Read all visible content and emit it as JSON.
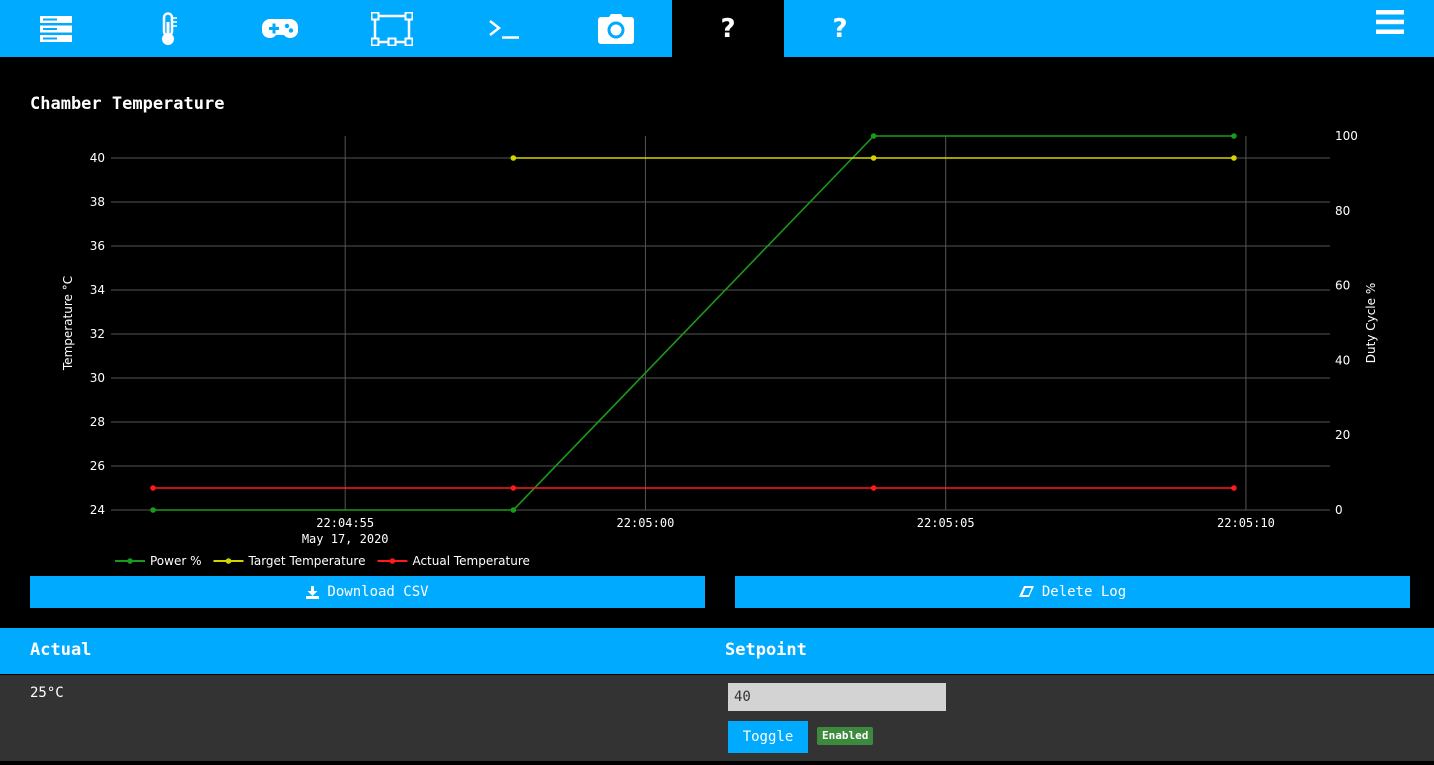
{
  "nav": {
    "tabs": [
      {
        "icon": "server-icon"
      },
      {
        "icon": "thermometer-icon"
      },
      {
        "icon": "gamepad-icon"
      },
      {
        "icon": "bounding-box-icon"
      },
      {
        "icon": "terminal-icon"
      },
      {
        "icon": "camera-icon"
      },
      {
        "icon": "question-icon",
        "label": "?",
        "active": true
      },
      {
        "icon": "question-icon",
        "label": "?"
      }
    ],
    "menu_icon": "hamburger-menu-icon"
  },
  "chart_title": "Chamber Temperature",
  "chart_data": {
    "type": "line",
    "title": "Chamber Temperature",
    "ylabel": "Temperature °C",
    "y2label": "Duty Cycle %",
    "ylim": [
      24,
      41
    ],
    "y2lim": [
      0,
      100
    ],
    "yticks": [
      "40",
      "38",
      "36",
      "34",
      "32",
      "30",
      "28",
      "26",
      "24"
    ],
    "y2ticks": [
      "100",
      "80",
      "60",
      "40",
      "20",
      "0"
    ],
    "xlim": [
      "22:04:51.1",
      "22:05:11.4"
    ],
    "xticks": [
      {
        "t": "22:04:55",
        "label": "22:04:55",
        "sub": "May 17, 2020"
      },
      {
        "t": "22:05:00",
        "label": "22:05:00"
      },
      {
        "t": "22:05:05",
        "label": "22:05:05"
      },
      {
        "t": "22:05:10",
        "label": "22:05:10"
      }
    ],
    "grid": true,
    "legend_position": "bottom-left",
    "series": [
      {
        "name": "Power %",
        "axis": "y2",
        "color": "#1a9a1a",
        "x": [
          "22:04:51.8",
          "22:04:57.8",
          "22:05:03.8",
          "22:05:09.8"
        ],
        "values": [
          0,
          0,
          100,
          100
        ]
      },
      {
        "name": "Target Temperature",
        "axis": "y",
        "color": "#d4d400",
        "x": [
          "22:04:57.8",
          "22:05:03.8",
          "22:05:09.8"
        ],
        "values": [
          40,
          40,
          40
        ]
      },
      {
        "name": "Actual Temperature",
        "axis": "y",
        "color": "#ff1a1a",
        "x": [
          "22:04:51.8",
          "22:04:57.8",
          "22:05:03.8",
          "22:05:09.8"
        ],
        "values": [
          25,
          25,
          25,
          25
        ]
      }
    ]
  },
  "buttons": {
    "download_label": "Download CSV",
    "download_icon": "download-icon",
    "delete_label": "Delete Log",
    "delete_icon": "eraser-icon"
  },
  "status": {
    "actual_heading": "Actual",
    "actual_value": "25°C",
    "setpoint_heading": "Setpoint",
    "setpoint_value": "40",
    "toggle_label": "Toggle",
    "badge": "Enabled",
    "badge_color": "#3c8a3c"
  },
  "colors": {
    "accent": "#00aaff",
    "panel": "#333333",
    "background": "#000000"
  }
}
